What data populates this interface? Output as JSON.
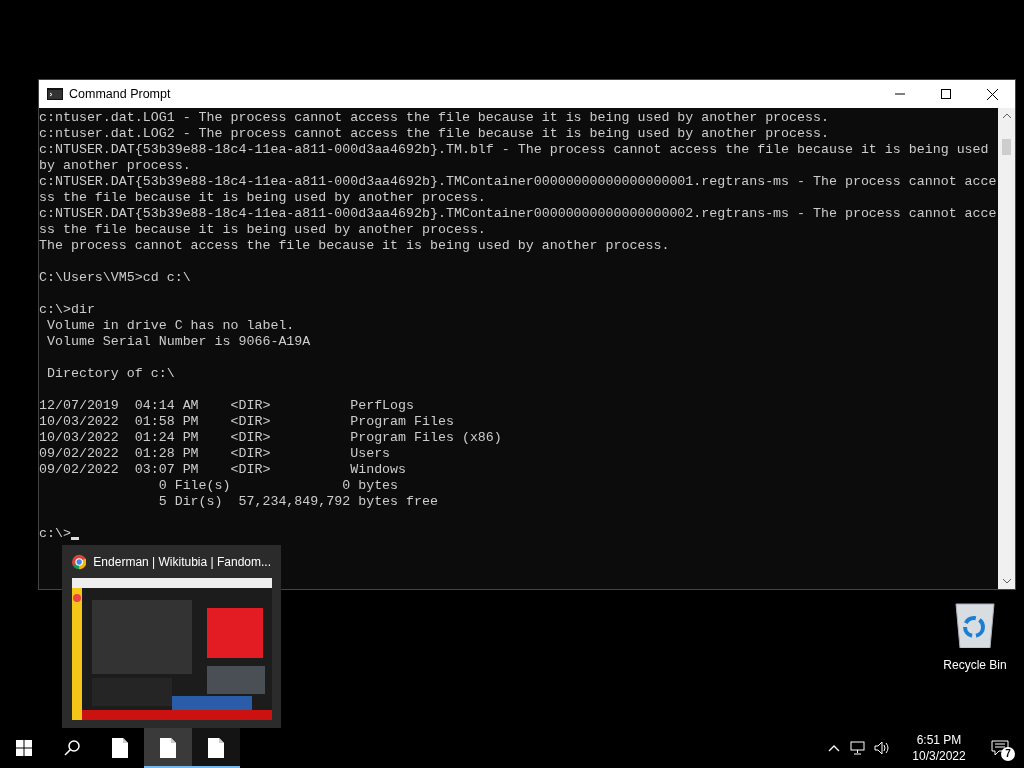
{
  "window": {
    "title": "Command Prompt"
  },
  "console": {
    "blocks": [
      [
        "c:ntuser.dat.LOG1 - The process cannot access the file because it is being used by another process.",
        "c:ntuser.dat.LOG2 - The process cannot access the file because it is being used by another process.",
        "c:NTUSER.DAT{53b39e88-18c4-11ea-a811-000d3aa4692b}.TM.blf - The process cannot access the file because it is being used",
        "by another process.",
        "c:NTUSER.DAT{53b39e88-18c4-11ea-a811-000d3aa4692b}.TMContainer00000000000000000001.regtrans-ms - The process cannot acce",
        "ss the file because it is being used by another process.",
        "c:NTUSER.DAT{53b39e88-18c4-11ea-a811-000d3aa4692b}.TMContainer00000000000000000002.regtrans-ms - The process cannot acce",
        "ss the file because it is being used by another process.",
        "The process cannot access the file because it is being used by another process."
      ],
      [
        "C:\\Users\\VM5>cd c:\\"
      ],
      [
        "c:\\>dir",
        " Volume in drive C has no label.",
        " Volume Serial Number is 9066-A19A"
      ],
      [
        " Directory of c:\\"
      ],
      [
        "12/07/2019  04:14 AM    <DIR>          PerfLogs",
        "10/03/2022  01:58 PM    <DIR>          Program Files",
        "10/03/2022  01:24 PM    <DIR>          Program Files (x86)",
        "09/02/2022  01:28 PM    <DIR>          Users",
        "09/02/2022  03:07 PM    <DIR>          Windows",
        "               0 File(s)              0 bytes",
        "               5 Dir(s)  57,234,849,792 bytes free"
      ],
      [
        "c:\\>"
      ]
    ]
  },
  "thumbnail": {
    "title": "Enderman | Wikitubia | Fandom...",
    "kind": "picture"
  },
  "desktop_icons": [
    {
      "label": "Recycle Bin"
    }
  ],
  "taskbar": {
    "apps": [
      {
        "running": false,
        "highlighted": false
      },
      {
        "running": true,
        "highlighted": true
      },
      {
        "running": true,
        "highlighted": false
      }
    ],
    "time": "6:51 PM",
    "date": "10/3/2022",
    "notifications": "7"
  }
}
